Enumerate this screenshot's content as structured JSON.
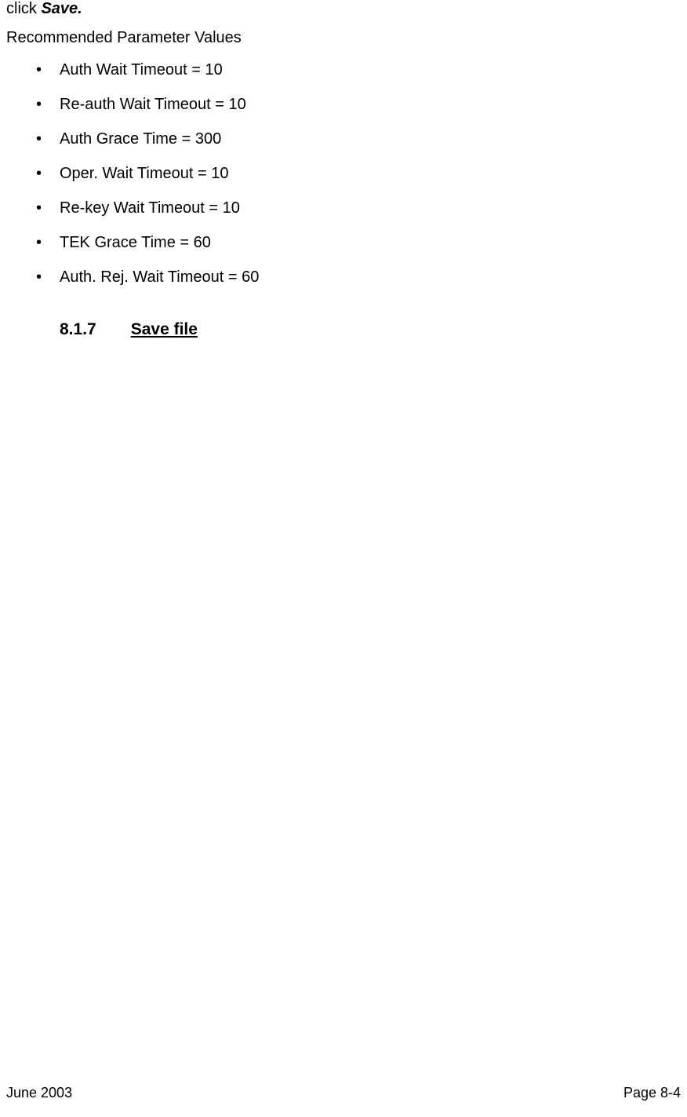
{
  "clickLine": {
    "prefix": "click ",
    "emphasis": "Save."
  },
  "recTitle": "Recommended Parameter Values",
  "bullets": [
    "Auth Wait Timeout = 10",
    "Re-auth Wait Timeout = 10",
    "Auth Grace Time = 300",
    "Oper. Wait Timeout = 10",
    "Re-key Wait Timeout = 10",
    "TEK Grace Time = 60",
    "Auth. Rej. Wait Timeout = 60"
  ],
  "section": {
    "number": "8.1.7",
    "title": "Save file"
  },
  "footer": {
    "left": "June 2003",
    "right": "Page 8-4"
  }
}
